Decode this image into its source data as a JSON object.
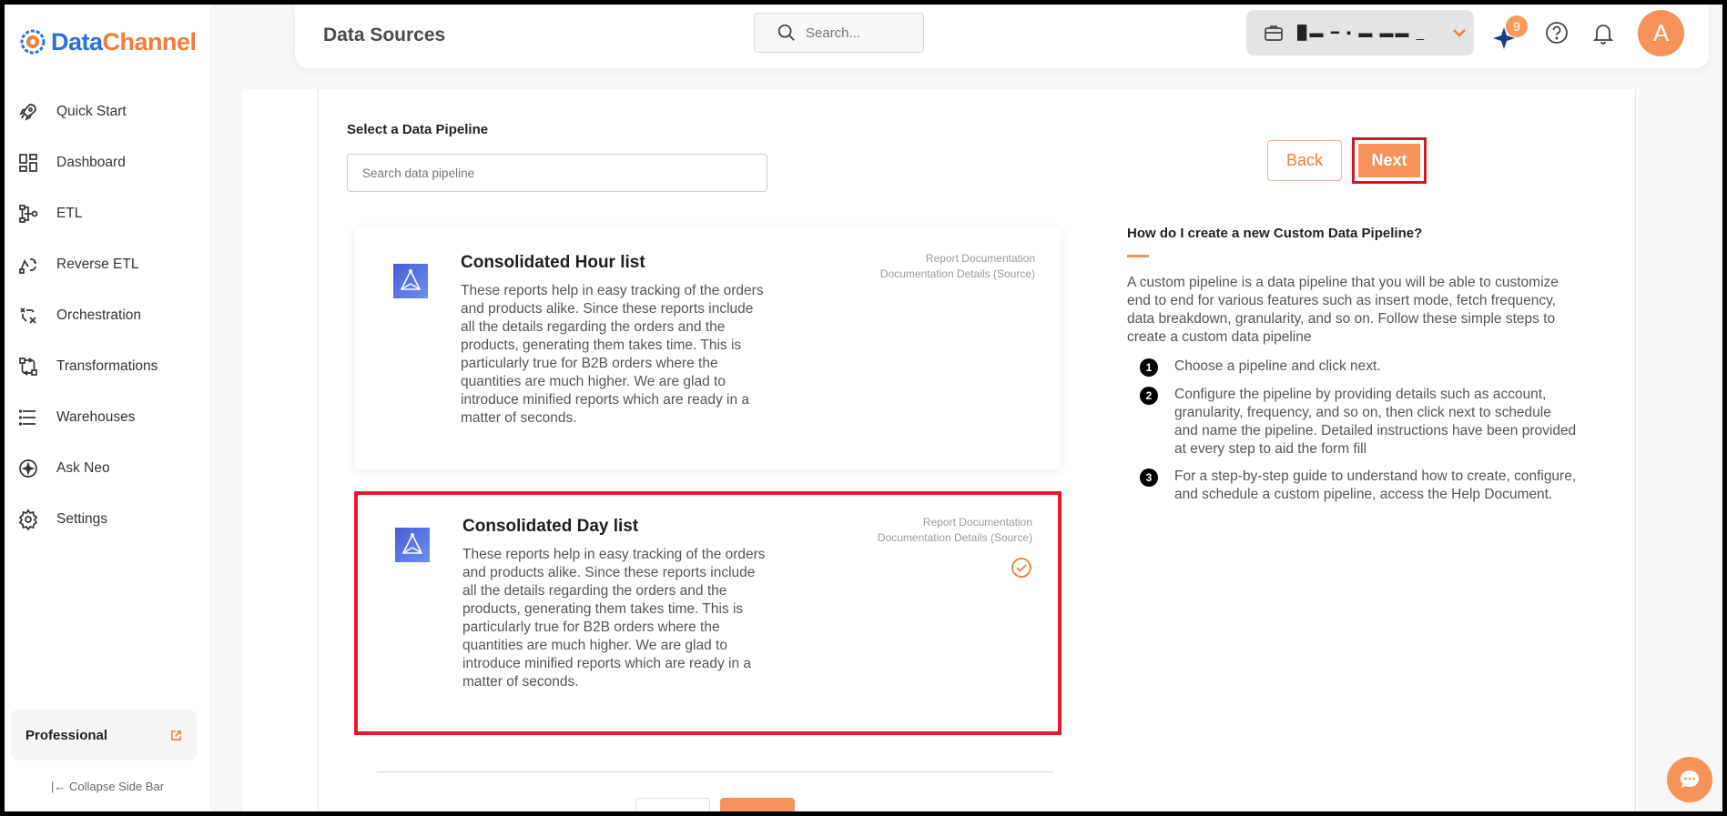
{
  "brand": {
    "name_part1": "Data",
    "name_part2": "Channel"
  },
  "sidebar": {
    "items": [
      {
        "label": "Quick Start",
        "icon": "rocket-icon"
      },
      {
        "label": "Dashboard",
        "icon": "dashboard-icon"
      },
      {
        "label": "ETL",
        "icon": "etl-icon"
      },
      {
        "label": "Reverse ETL",
        "icon": "reverse-etl-icon"
      },
      {
        "label": "Orchestration",
        "icon": "orchestration-icon"
      },
      {
        "label": "Transformations",
        "icon": "transformations-icon"
      },
      {
        "label": "Warehouses",
        "icon": "warehouses-icon"
      },
      {
        "label": "Ask Neo",
        "icon": "ask-neo-icon"
      },
      {
        "label": "Settings",
        "icon": "gear-icon"
      }
    ],
    "plan_label": "Professional",
    "collapse_label": "Collapse Side Bar"
  },
  "header": {
    "title": "Data Sources",
    "search_placeholder": "Search...",
    "account_name": "▉▬ ━ ▪ ▬ ▬▬ _",
    "notification_count": "9",
    "avatar_initial": "A"
  },
  "main": {
    "section_label": "Select a Data Pipeline",
    "search_placeholder": "Search data pipeline",
    "back_label": "Back",
    "next_label": "Next",
    "pipelines": [
      {
        "title": "Consolidated Hour list",
        "description": "These reports help in easy tracking of the orders and products alike. Since these reports include all the details regarding the orders and the products, generating them takes time. This is particularly true for B2B orders where the quantities are much higher. We are glad to introduce minified reports which are ready in a matter of seconds.",
        "link1": "Report Documentation",
        "link2": "Documentation Details (Source)",
        "selected": false
      },
      {
        "title": "Consolidated Day list",
        "description": "These reports help in easy tracking of the orders and products alike. Since these reports include all the details regarding the orders and the products, generating them takes time. This is particularly true for B2B orders where the quantities are much higher. We are glad to introduce minified reports which are ready in a matter of seconds.",
        "link1": "Report Documentation",
        "link2": "Documentation Details (Source)",
        "selected": true
      }
    ]
  },
  "help": {
    "title": "How do I create a new Custom Data Pipeline?",
    "intro": "A custom pipeline is a data pipeline that you will be able to customize end to end for various features such as insert mode, fetch frequency, data breakdown, granularity, and so on. Follow these simple steps to create a custom data pipeline",
    "steps": [
      {
        "num": "1",
        "text": "Choose a pipeline and click next."
      },
      {
        "num": "2",
        "text": "Configure the pipeline by providing details such as account, granularity, frequency, and so on, then click next to schedule and name the pipeline. Detailed instructions have been provided at every step to aid the form fill"
      },
      {
        "num": "3",
        "text": "For a step-by-step guide to understand how to create, configure, and schedule a custom pipeline, access the Help Document."
      }
    ]
  },
  "colors": {
    "accent": "#f5935b",
    "brand_blue": "#2a6fdb",
    "highlight_red": "#e41a2c"
  }
}
